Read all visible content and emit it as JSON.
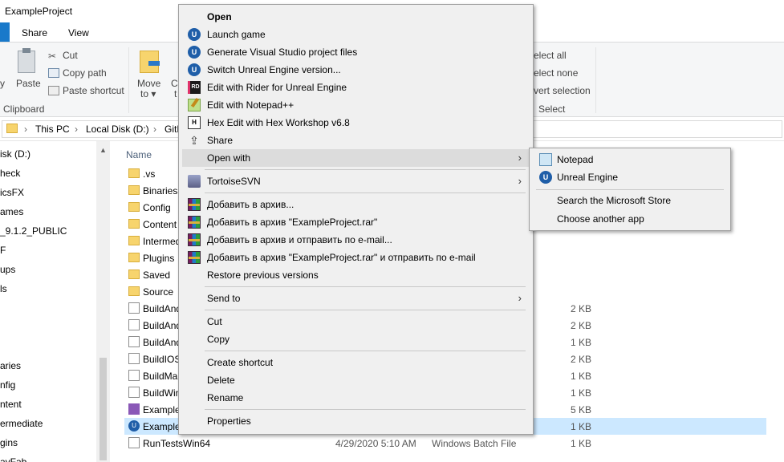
{
  "window": {
    "title": "ExampleProject",
    "tabs": [
      "Share",
      "View"
    ]
  },
  "ribbon": {
    "clipboard": {
      "paste_partial": "y",
      "paste": "Paste",
      "cut": "Cut",
      "copy_path": "Copy path",
      "paste_shortcut": "Paste shortcut",
      "group": "Clipboard"
    },
    "organize": {
      "move_to": "Move",
      "move_to_2": "to ▾",
      "copy_partial": "Co",
      "copy_partial_2": "t"
    },
    "select": {
      "select_all": "elect all",
      "select_none": "elect none",
      "invert": "vert selection",
      "group": "Select"
    }
  },
  "address": {
    "segments": [
      "This PC",
      "Local Disk (D:)",
      "GitF"
    ]
  },
  "nav": {
    "items": [
      "isk (D:)",
      "heck",
      "icsFX",
      "ames",
      "_9.1.2_PUBLIC",
      "F",
      "ups",
      "ls",
      "aries",
      "nfig",
      "ntent",
      "ermediate",
      "gins",
      "ayFab"
    ]
  },
  "files": {
    "column_name": "Name",
    "rows": [
      {
        "name": ".vs",
        "kind": "folder",
        "size": "",
        "date": "",
        "type": ""
      },
      {
        "name": "Binaries",
        "kind": "folder",
        "size": "",
        "date": "",
        "type": ""
      },
      {
        "name": "Config",
        "kind": "folder",
        "size": "",
        "date": "",
        "type": ""
      },
      {
        "name": "Content",
        "kind": "folder",
        "size": "",
        "date": "",
        "type": ""
      },
      {
        "name": "Intermed",
        "kind": "folder",
        "size": "",
        "date": "",
        "type": ""
      },
      {
        "name": "Plugins",
        "kind": "folder",
        "size": "",
        "date": "",
        "type": ""
      },
      {
        "name": "Saved",
        "kind": "folder",
        "size": "",
        "date": "",
        "type": ""
      },
      {
        "name": "Source",
        "kind": "folder",
        "size": "",
        "date": "",
        "type": ""
      },
      {
        "name": "BuildAnd",
        "kind": "file",
        "size": "2 KB",
        "date": "",
        "type": ""
      },
      {
        "name": "BuildAnd",
        "kind": "file",
        "size": "2 KB",
        "date": "",
        "type": ""
      },
      {
        "name": "BuildAnd",
        "kind": "file",
        "size": "1 KB",
        "date": "",
        "type": ""
      },
      {
        "name": "BuildIOS",
        "kind": "file",
        "size": "2 KB",
        "date": "",
        "type": ""
      },
      {
        "name": "BuildMa",
        "kind": "file",
        "size": "1 KB",
        "date": "",
        "type": ""
      },
      {
        "name": "BuildWin",
        "kind": "file",
        "size": "1 KB",
        "date": "",
        "type": ""
      },
      {
        "name": "Example",
        "kind": "sln",
        "size": "5 KB",
        "date": "",
        "type": ""
      },
      {
        "name": "Example",
        "kind": "ue",
        "size": "1 KB",
        "date": "",
        "type": ""
      },
      {
        "name": "RunTestsWin64",
        "kind": "file",
        "size": "1 KB",
        "date": "4/29/2020 5:10 AM",
        "type": "Windows Batch File"
      }
    ]
  },
  "context_menu": {
    "items": [
      {
        "label": "Open",
        "icon": "none"
      },
      {
        "label": "Launch game",
        "icon": "unreal-icon"
      },
      {
        "label": "Generate Visual Studio project files",
        "icon": "unreal-icon"
      },
      {
        "label": "Switch Unreal Engine version...",
        "icon": "unreal-icon"
      },
      {
        "label": "Edit with Rider for Unreal Engine",
        "icon": "rider-icon"
      },
      {
        "label": "Edit with Notepad++",
        "icon": "notepadpp-icon"
      },
      {
        "label": "Hex Edit with Hex Workshop v6.8",
        "icon": "hex-workshop-icon"
      },
      {
        "label": "Share",
        "icon": "share-icon"
      },
      {
        "label": "Open with",
        "icon": "none"
      },
      {
        "label": "TortoiseSVN",
        "icon": "tortoisesvn-icon"
      },
      {
        "label": "Добавить в архив...",
        "icon": "winrar-icon"
      },
      {
        "label": "Добавить в архив \"ExampleProject.rar\"",
        "icon": "winrar-icon"
      },
      {
        "label": "Добавить в архив и отправить по e-mail...",
        "icon": "winrar-icon"
      },
      {
        "label": "Добавить в архив \"ExampleProject.rar\" и отправить по e-mail",
        "icon": "winrar-icon"
      },
      {
        "label": "Restore previous versions",
        "icon": "none"
      },
      {
        "label": "Send to",
        "icon": "none"
      },
      {
        "label": "Cut",
        "icon": "none"
      },
      {
        "label": "Copy",
        "icon": "none"
      },
      {
        "label": "Create shortcut",
        "icon": "none"
      },
      {
        "label": "Delete",
        "icon": "none"
      },
      {
        "label": "Rename",
        "icon": "none"
      },
      {
        "label": "Properties",
        "icon": "none"
      }
    ],
    "submenu_arrow": "›"
  },
  "open_with_submenu": {
    "items": [
      {
        "label": "Notepad",
        "icon": "notepad-icon"
      },
      {
        "label": "Unreal Engine",
        "icon": "unreal-icon"
      },
      {
        "label": "Search the Microsoft Store",
        "icon": "none"
      },
      {
        "label": "Choose another app",
        "icon": "none"
      }
    ]
  }
}
